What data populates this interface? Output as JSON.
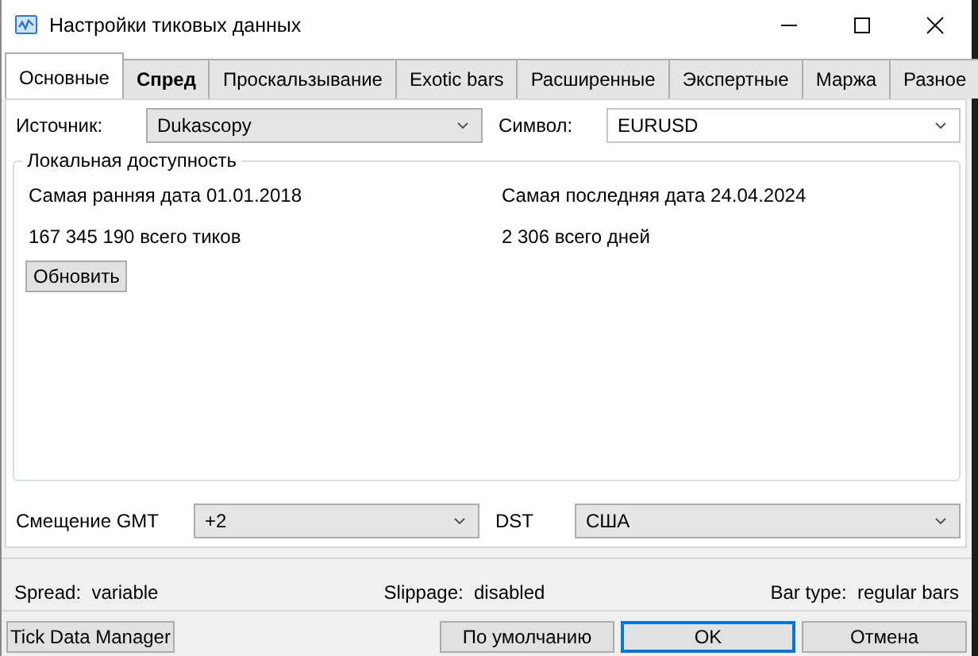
{
  "window": {
    "title": "Настройки тиковых данных"
  },
  "tabs": [
    {
      "label": "Основные",
      "selected": true,
      "bold": false
    },
    {
      "label": "Спред",
      "selected": false,
      "bold": true
    },
    {
      "label": "Проскальзывание",
      "selected": false,
      "bold": false
    },
    {
      "label": "Exotic bars",
      "selected": false,
      "bold": false
    },
    {
      "label": "Расширенные",
      "selected": false,
      "bold": false
    },
    {
      "label": "Экспертные",
      "selected": false,
      "bold": false
    },
    {
      "label": "Маржа",
      "selected": false,
      "bold": false
    },
    {
      "label": "Разное",
      "selected": false,
      "bold": false
    }
  ],
  "source": {
    "label": "Источник:",
    "value": "Dukascopy",
    "editable": false
  },
  "symbol": {
    "label": "Символ:",
    "value": "EURUSD",
    "editable": true
  },
  "local": {
    "title": "Локальная доступность",
    "earliest": "Самая ранняя дата 01.01.2018",
    "latest": "Самая последняя дата 24.04.2024",
    "ticks": "167 345 190 всего тиков",
    "days": "2 306 всего дней",
    "refresh": "Обновить"
  },
  "gmt": {
    "label": "Смещение GMT",
    "value": "+2",
    "editable": false
  },
  "dst": {
    "label": "DST",
    "value": "США",
    "editable": false
  },
  "status": [
    {
      "label": "Spread:",
      "value": "variable"
    },
    {
      "label": "Slippage:",
      "value": "disabled"
    },
    {
      "label": "Bar type:",
      "value": "regular bars"
    }
  ],
  "buttons": [
    {
      "label": "Tick Data Manager",
      "default": false
    },
    {
      "label": "По умолчанию",
      "default": false
    },
    {
      "label": "OK",
      "default": true
    },
    {
      "label": "Отмена",
      "default": false
    }
  ]
}
